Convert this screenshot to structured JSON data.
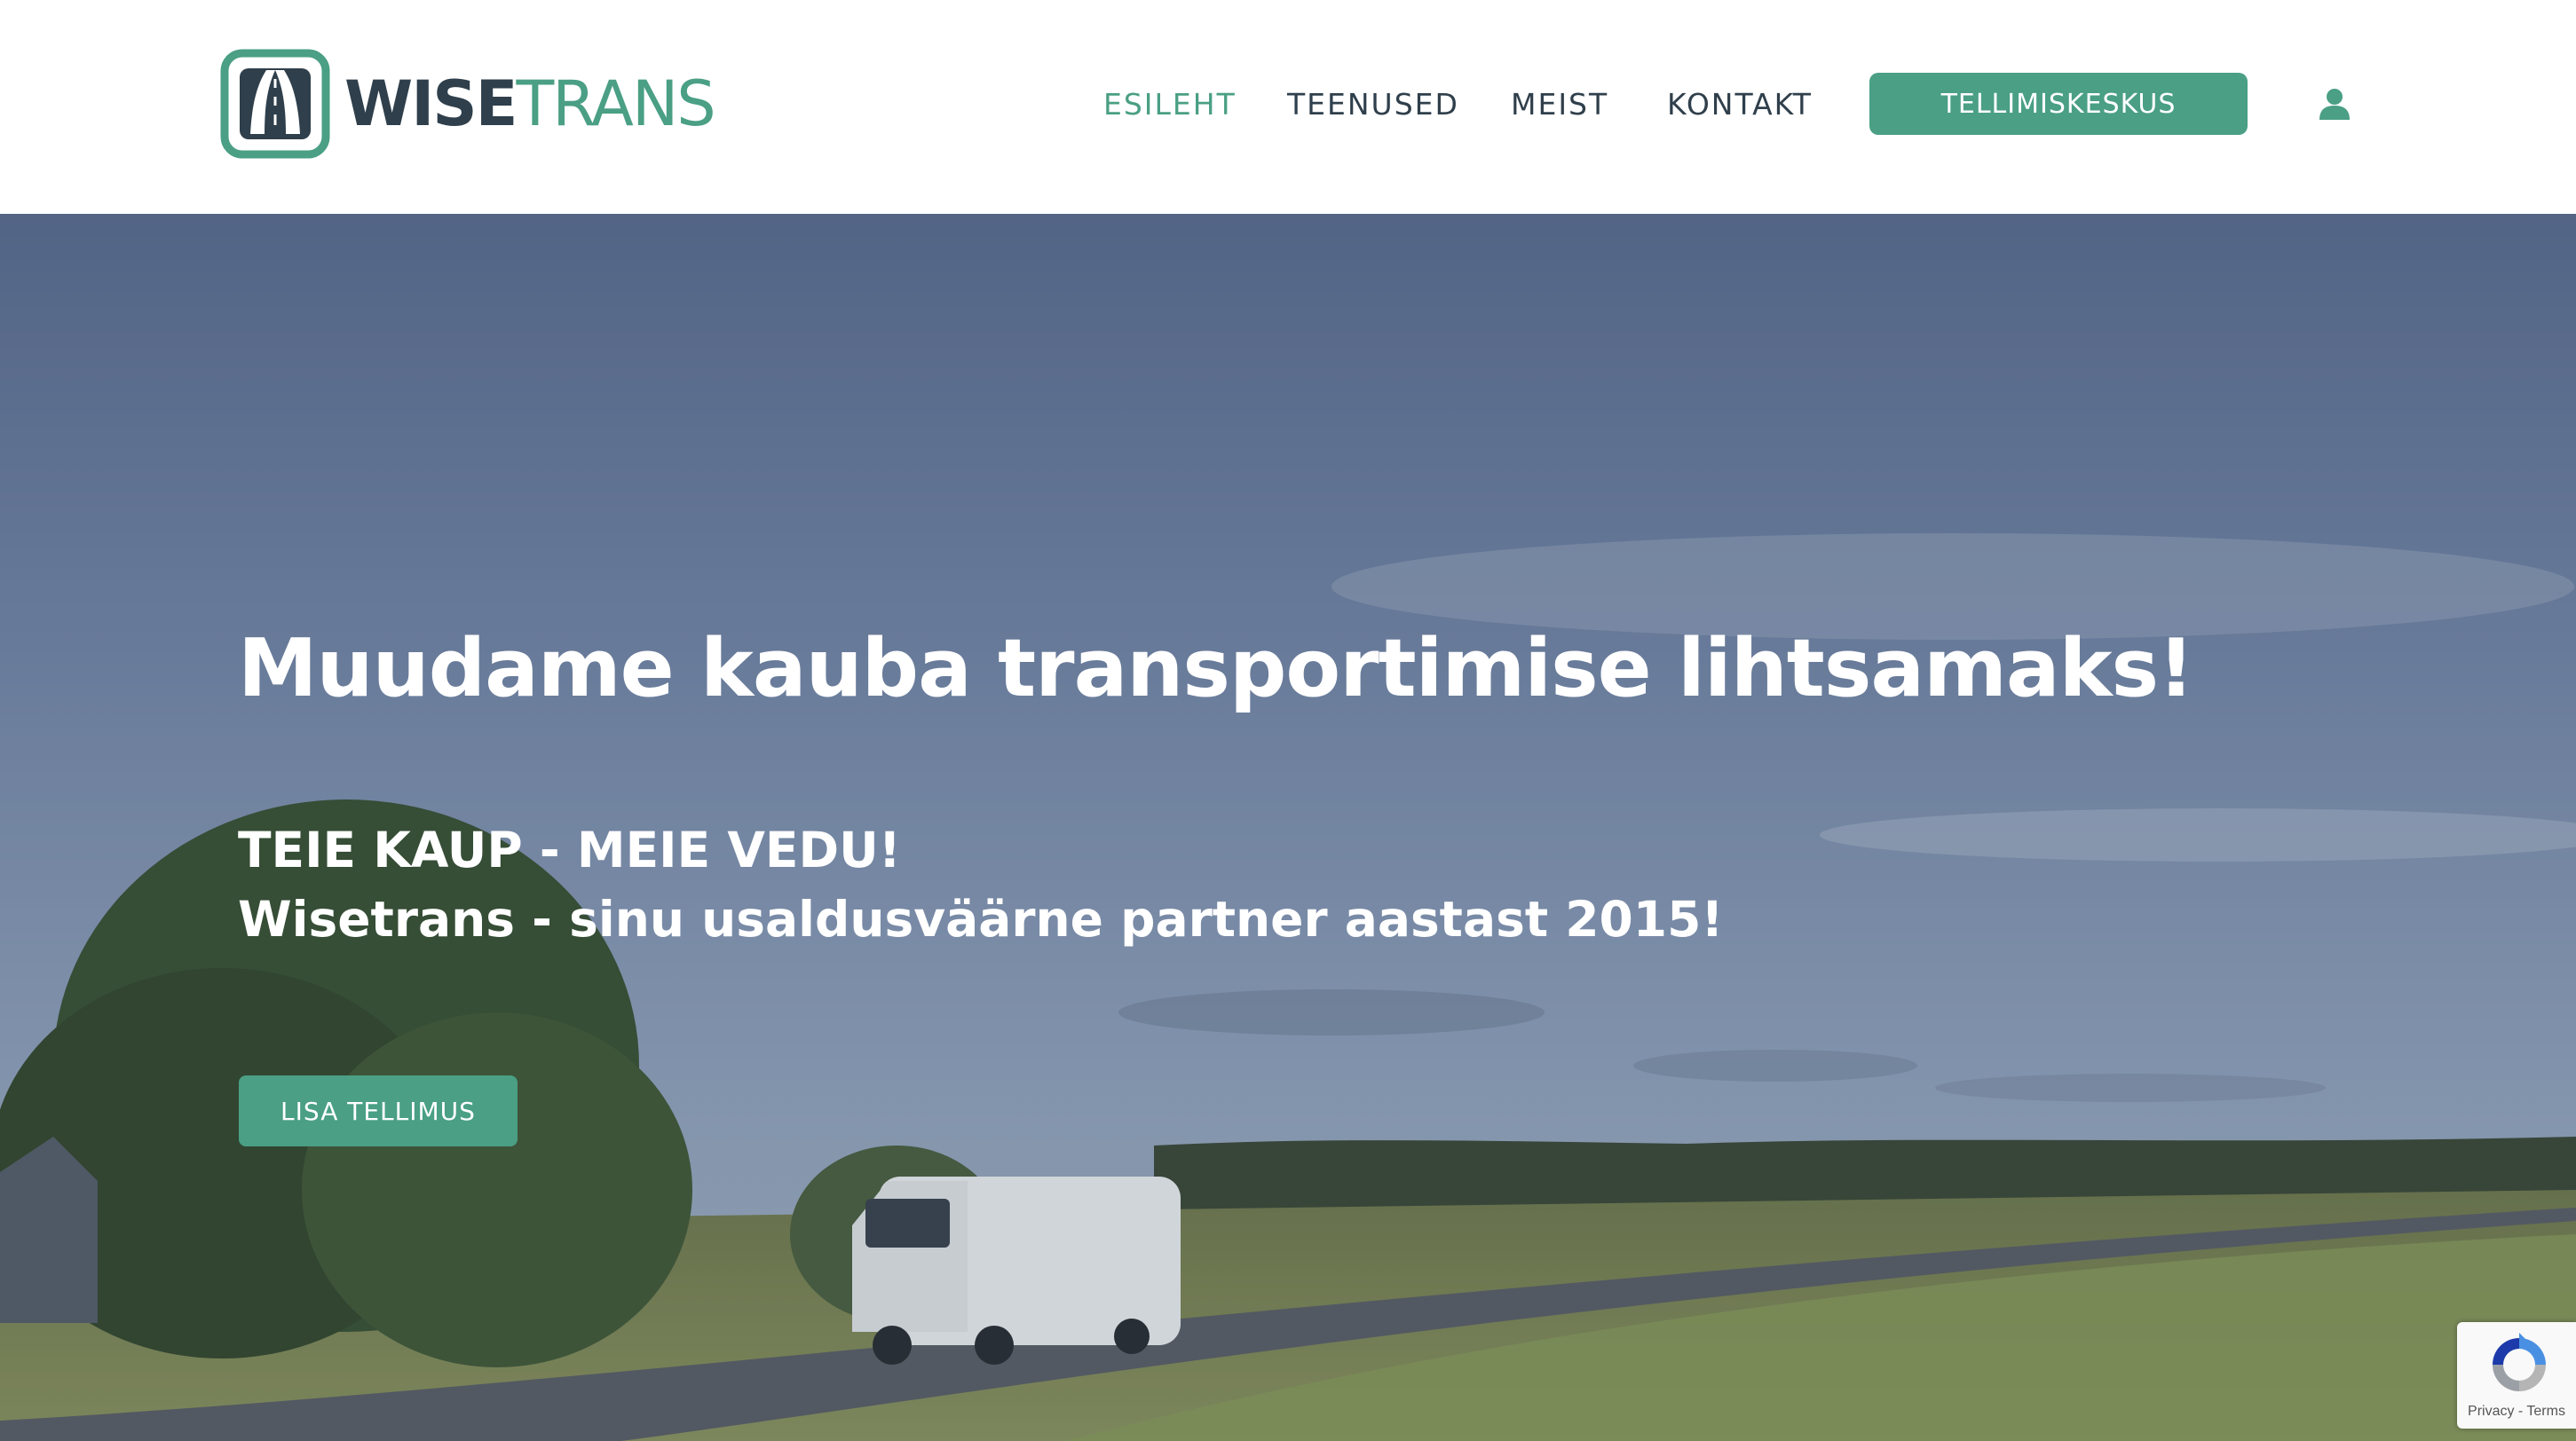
{
  "brand": {
    "name_part1": "WISE",
    "name_part2": "TRANS",
    "logo_icon": "road-w-logo-icon",
    "primary_color": "#4a9f84",
    "dark_color": "#2f3f4b"
  },
  "nav": {
    "items": [
      {
        "label": "ESILEHT",
        "active": true
      },
      {
        "label": "TEENUSED",
        "active": false
      },
      {
        "label": "MEIST",
        "active": false
      },
      {
        "label": "KONTAKT",
        "active": false
      }
    ],
    "cta_label": "TELLIMISKESKUS",
    "account_icon": "user-icon"
  },
  "hero": {
    "title": "Muudame kauba transportimise lihtsamaks!",
    "tagline_line1": "TEIE KAUP - MEIE VEDU!",
    "tagline_line2": "Wisetrans - sinu usaldusväärne partner aastast 2015!",
    "button_label": "LISA TELLIMUS"
  },
  "recaptcha": {
    "icon": "recaptcha-icon",
    "privacy_label": "Privacy",
    "separator": " - ",
    "terms_label": "Terms"
  }
}
